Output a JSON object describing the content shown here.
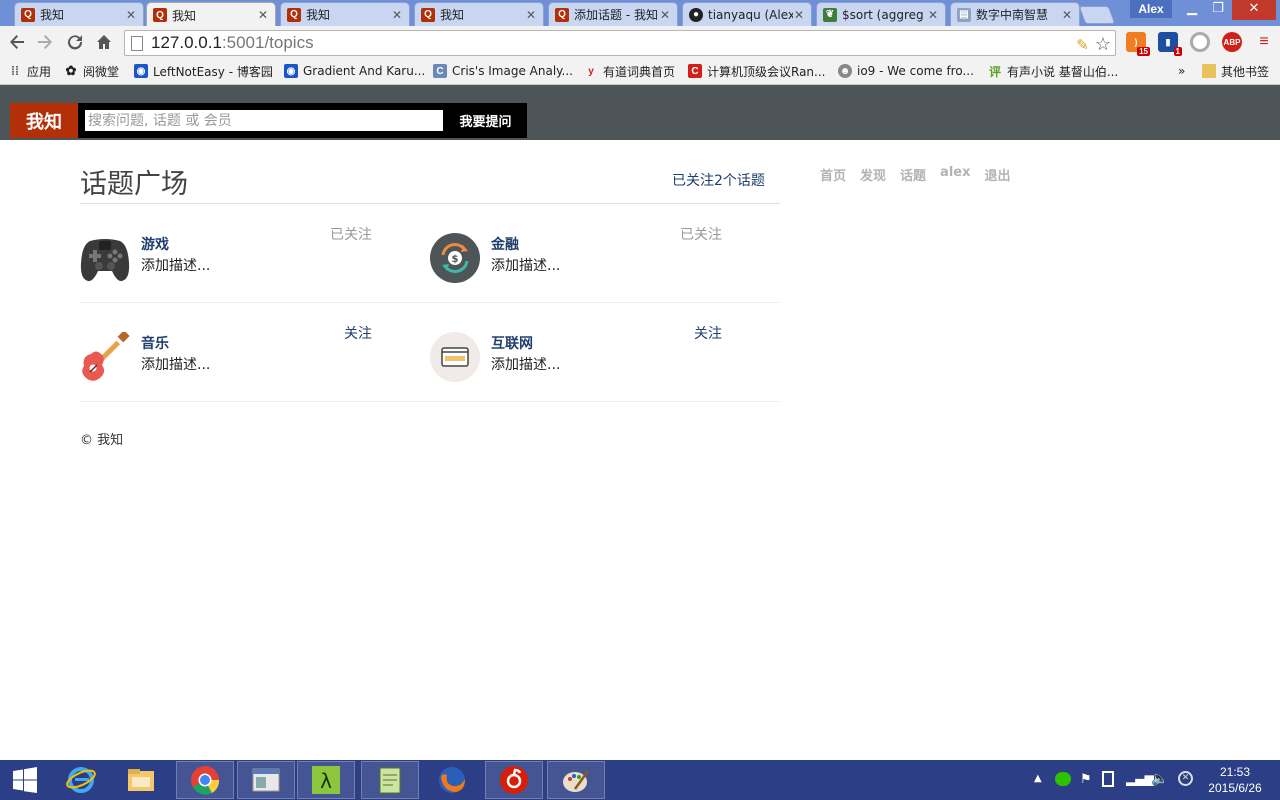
{
  "browser": {
    "tabs": [
      {
        "title": "我知",
        "favicon": "zhiwo-q-icon",
        "active": false
      },
      {
        "title": "我知",
        "favicon": "zhiwo-q-icon",
        "active": true
      },
      {
        "title": "我知",
        "favicon": "zhiwo-q-icon",
        "active": false
      },
      {
        "title": "我知",
        "favicon": "zhiwo-q-icon",
        "active": false
      },
      {
        "title": "添加话题 - 我知",
        "favicon": "zhiwo-q-icon",
        "active": false
      },
      {
        "title": "tianyaqu (Alex",
        "favicon": "github-icon",
        "active": false
      },
      {
        "title": "$sort (aggreg",
        "favicon": "mongodb-leaf-icon",
        "active": false
      },
      {
        "title": "数字中南智慧",
        "favicon": "image-doc-icon",
        "active": false
      }
    ],
    "profile_name": "Alex",
    "url_host": "127.0.0.1",
    "url_path": ":5001/topics",
    "extensions": [
      {
        "name": "rss-icon",
        "badge": "15"
      },
      {
        "name": "stats-icon",
        "badge": "1"
      },
      {
        "name": "circle-icon",
        "badge": ""
      },
      {
        "name": "adblock-icon",
        "badge": "ABP"
      },
      {
        "name": "menu-icon",
        "badge": ""
      }
    ],
    "bookmarks_apps_label": "应用",
    "bookmarks": [
      {
        "label": "阅微堂",
        "icon": "zhuoyue-icon"
      },
      {
        "label": "LeftNotEasy - 博客园",
        "icon": "cnblogs-icon"
      },
      {
        "label": "Gradient And Karu...",
        "icon": "cnblogs-icon"
      },
      {
        "label": "Cris's Image Analy...",
        "icon": "c-icon"
      },
      {
        "label": "有道词典首页",
        "icon": "youdao-icon"
      },
      {
        "label": "计算机顶级会议Ran...",
        "icon": "c-red-icon"
      },
      {
        "label": "io9 - We come fro...",
        "icon": "io9-icon"
      },
      {
        "label": "有声小说 基督山伯...",
        "icon": "ping-icon"
      }
    ],
    "bookmarks_more": "»",
    "other_bookmarks_label": "其他书签"
  },
  "site": {
    "logo": "我知",
    "search_placeholder": "搜索问题, 话题 或 会员",
    "ask_button": "我要提问",
    "nav": [
      "首页",
      "发现",
      "话题",
      "alex",
      "退出"
    ]
  },
  "page": {
    "title": "话题广场",
    "followed_summary": "已关注2个话题",
    "topics": [
      {
        "name": "游戏",
        "description": "添加描述...",
        "follow_label": "已关注",
        "followed": true,
        "icon": "gamepad-icon"
      },
      {
        "name": "金融",
        "description": "添加描述...",
        "follow_label": "已关注",
        "followed": true,
        "icon": "finance-icon"
      },
      {
        "name": "音乐",
        "description": "添加描述...",
        "follow_label": "关注",
        "followed": false,
        "icon": "guitar-icon"
      },
      {
        "name": "互联网",
        "description": "添加描述...",
        "follow_label": "关注",
        "followed": false,
        "icon": "web-browser-icon"
      }
    ],
    "footer": "© 我知"
  },
  "taskbar": {
    "apps": [
      "start-icon",
      "ie-icon",
      "explorer-icon",
      "chrome-icon",
      "window-icon",
      "lambda-icon",
      "notepad-icon",
      "firefox-icon",
      "netease-music-icon",
      "paint-icon"
    ],
    "clock_time": "21:53",
    "clock_date": "2015/6/26"
  },
  "colors": {
    "site_header": "#4d5559",
    "logo_bg": "#b32f07",
    "link": "#1f3f6e",
    "muted": "#999999"
  }
}
